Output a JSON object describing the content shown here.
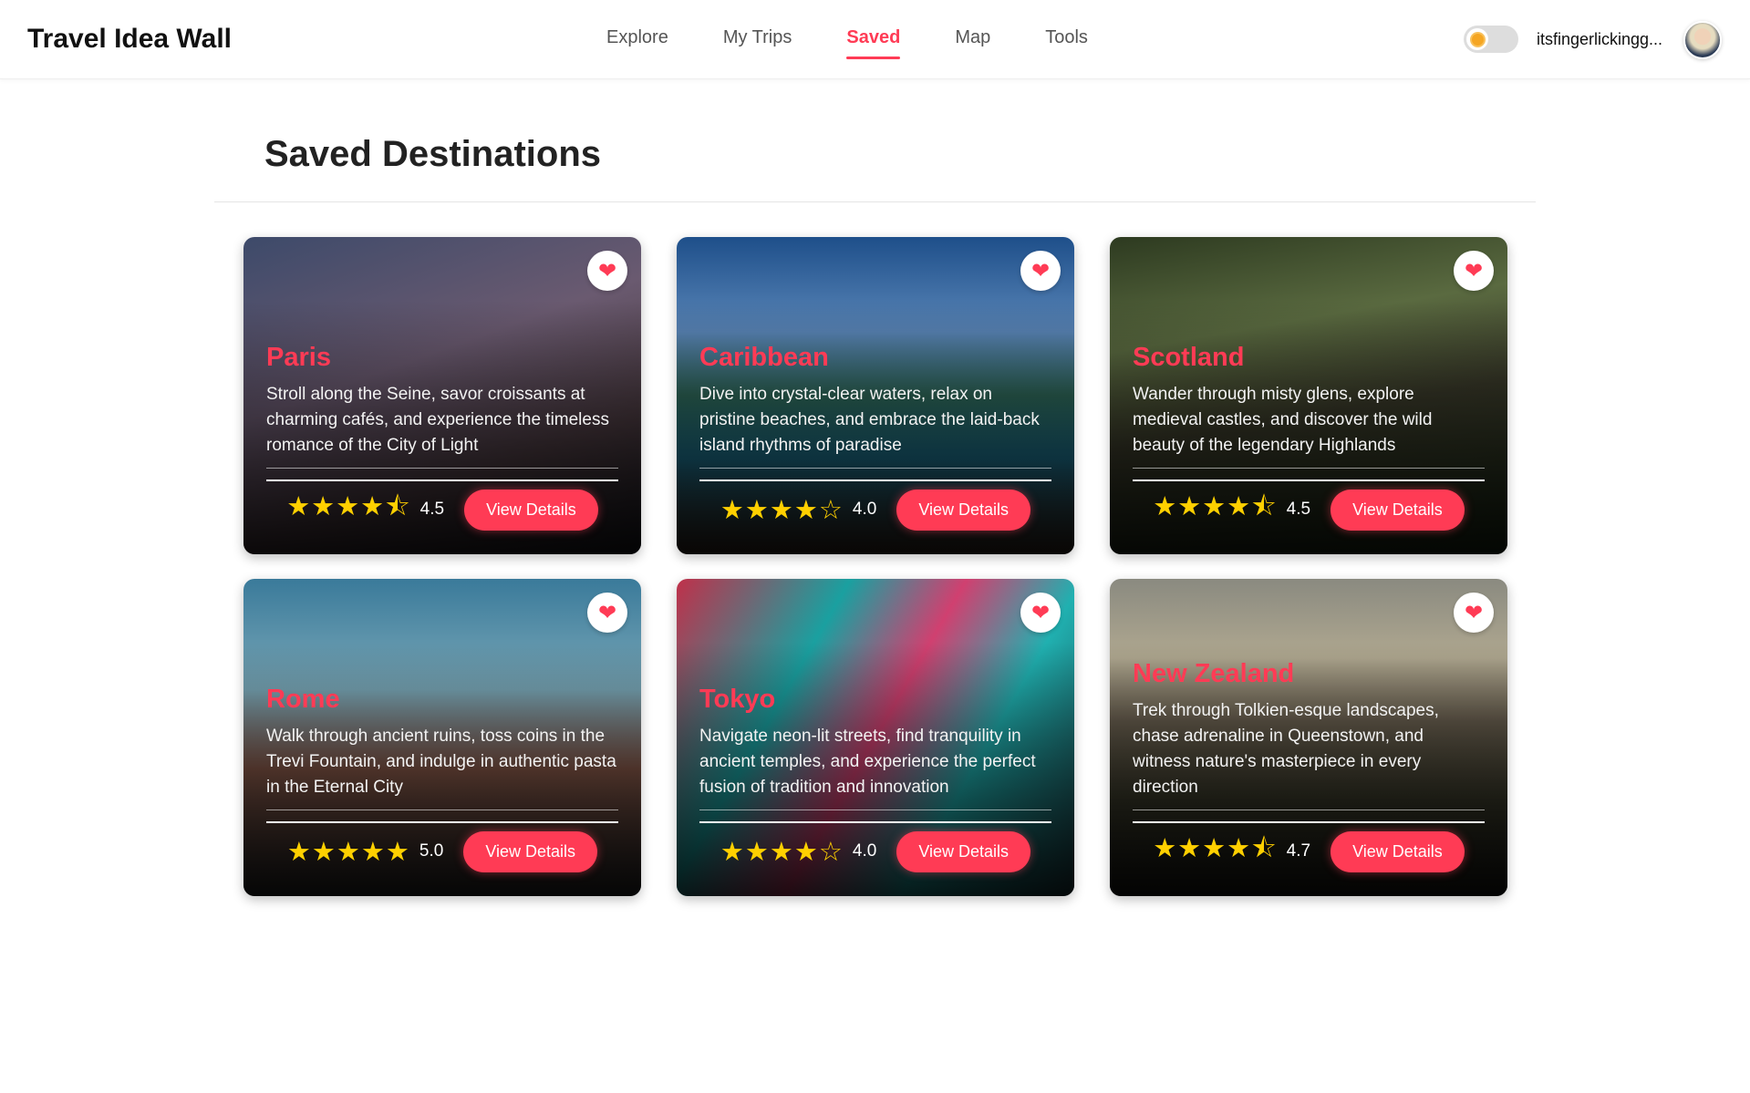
{
  "header": {
    "brand": "Travel Idea Wall",
    "nav": [
      "Explore",
      "My Trips",
      "Saved",
      "Map",
      "Tools"
    ],
    "active": "Saved",
    "username": "itsfingerlickingg..."
  },
  "page": {
    "title": "Saved Destinations"
  },
  "colors": {
    "accent": "#ff3b55",
    "star": "#ffd000"
  },
  "cards": [
    {
      "name": "Paris",
      "desc": "Stroll along the Seine, savor croissants at charming cafés, and experience the timeless romance of the City of Light",
      "rating": "4.5",
      "stars": "★★★★⯪",
      "button": "View Details",
      "bg": "linear-gradient(160deg,#3d4a6a,#6a5a70 40%,#4a3a40 70%,#1a1a20)"
    },
    {
      "name": "Caribbean",
      "desc": "Dive into crystal-clear waters, relax on pristine beaches, and embrace the laid-back island rhythms of paradise",
      "rating": "4.0",
      "stars": "★★★★☆",
      "button": "View Details",
      "bg": "linear-gradient(180deg,#1e4f8a,#5a86b8 30%,#2f6a5a 50%,#1c6e8a 70%,#3a2a20)"
    },
    {
      "name": "Scotland",
      "desc": "Wander through misty glens, explore medieval castles, and discover the wild beauty of the legendary Highlands",
      "rating": "4.5",
      "stars": "★★★★⯪",
      "button": "View Details",
      "bg": "linear-gradient(170deg,#2d3a20,#5a6a40 30%,#3a3a2a 55%,#1a2a15)"
    },
    {
      "name": "Rome",
      "desc": "Walk through ancient ruins, toss coins in the Trevi Fountain, and indulge in authentic pasta in the Eternal City",
      "rating": "5.0",
      "stars": "★★★★★",
      "button": "View Details",
      "bg": "linear-gradient(180deg,#3a7a9a,#7aa8b8 35%,#8a5a4a 60%,#2a2a2a)"
    },
    {
      "name": "Tokyo",
      "desc": "Navigate neon-lit streets, find tranquility in ancient temples, and experience the perfect fusion of tradition and innovation",
      "rating": "4.0",
      "stars": "★★★★☆",
      "button": "View Details",
      "bg": "linear-gradient(120deg,#c0304a,#1aa0a0 30%,#d04070 50%,#20b0b0 70%,#1a3a40)"
    },
    {
      "name": "New Zealand",
      "desc": "Trek through Tolkien-esque landscapes, chase adrenaline in Queenstown, and witness nature's masterpiece in every direction",
      "rating": "4.7",
      "stars": "★★★★⯪",
      "button": "View Details",
      "bg": "linear-gradient(180deg,#8a8a80,#b0a890 25%,#6a6050 45%,#3a3a2a 70%,#1a1a15)"
    }
  ]
}
